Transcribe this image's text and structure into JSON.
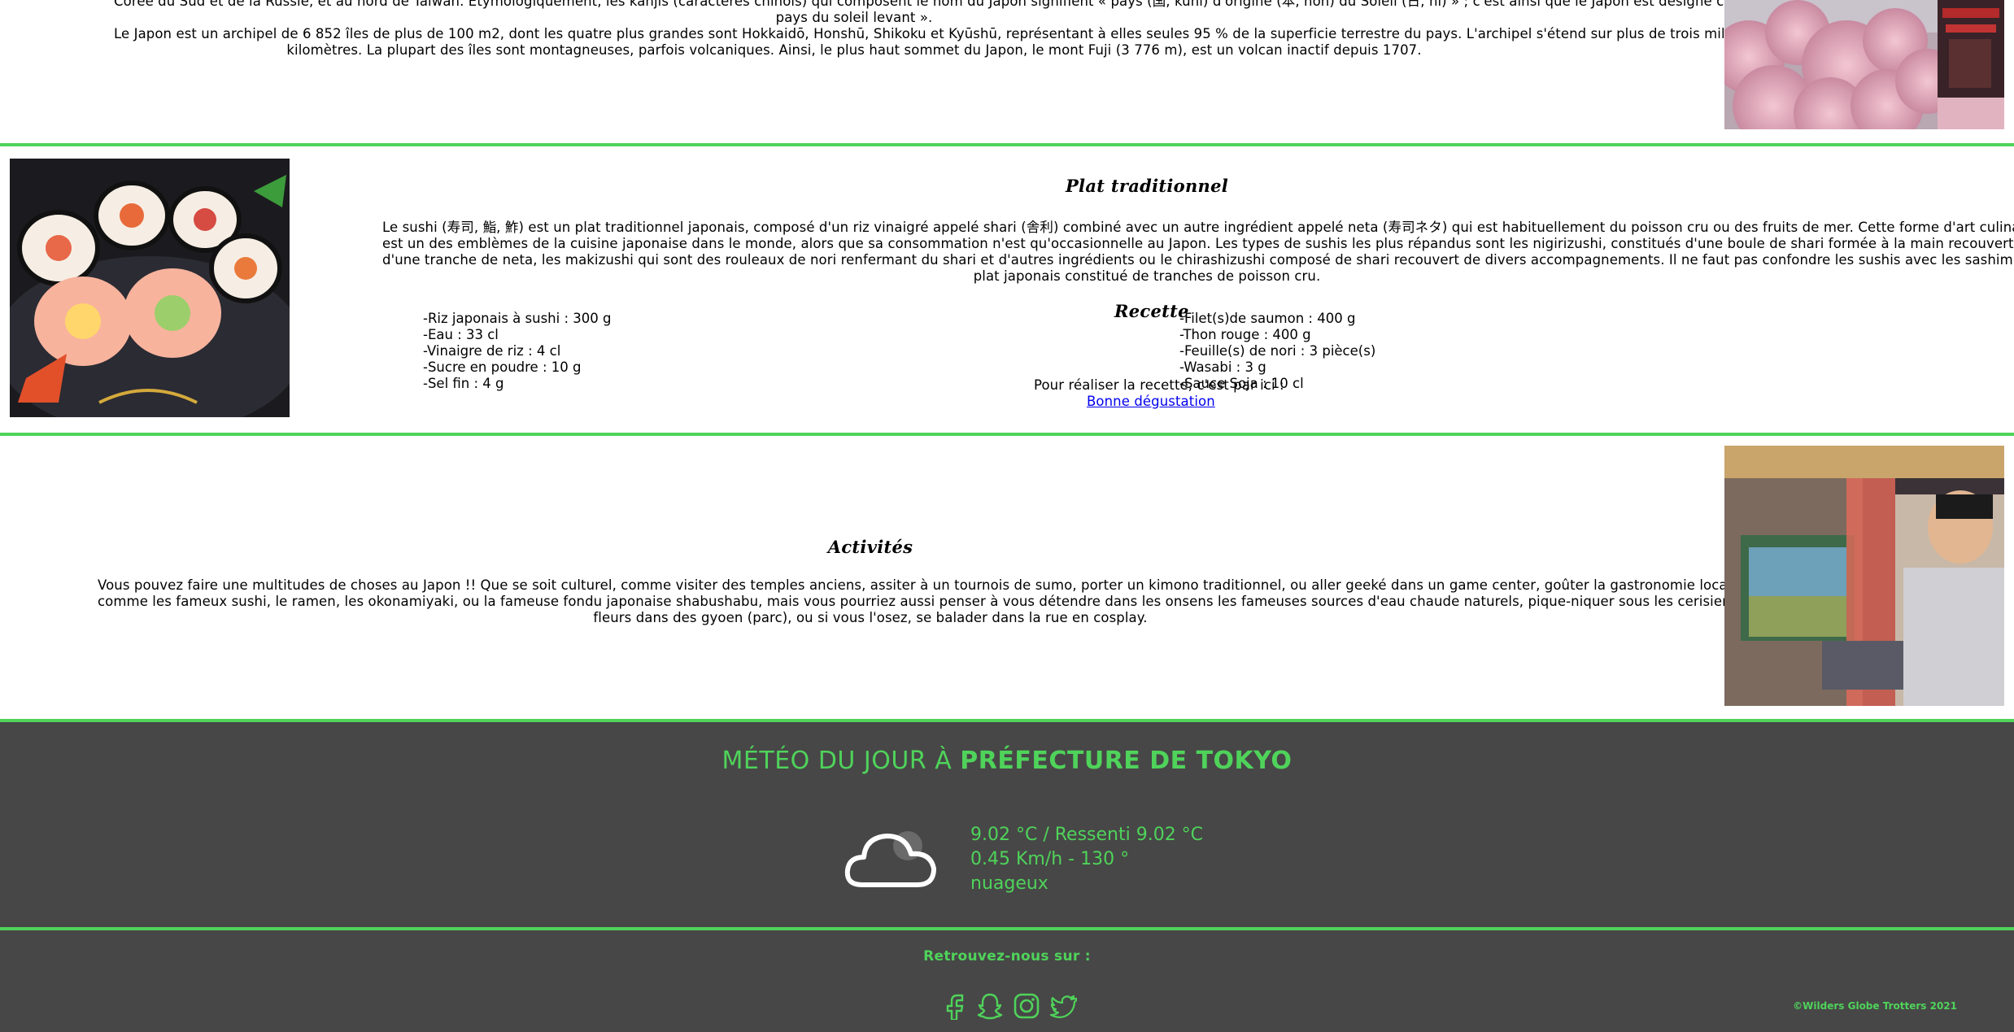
{
  "intro": {
    "line1": "Corée du Sud et de la Russie, et au nord de Taïwan. Étymologiquement, les kanjis (caractères chinois) qui composent le nom du Japon signifient « pays (国, kuni) d'origine (本, hon) du Soleil (日, hi) » ; c'est ainsi que le Japon est désigné comme le «",
    "line2": "pays du soleil levant ».",
    "line3": "Le Japon est un archipel de 6 852 îles de plus de 100 m2, dont les quatre plus grandes sont Hokkaidō, Honshū, Shikoku et Kyūshū, représentant à elles seules 95 % de la superficie terrestre du pays. L'archipel s'étend sur plus de trois mille",
    "line4": "kilomètres. La plupart des îles sont montagneuses, parfois volcaniques. Ainsi, le plus haut sommet du Japon, le mont Fuji (3 776 m), est un volcan inactif depuis 1707."
  },
  "plat": {
    "title": "Plat traditionnel",
    "text1": "Le sushi (寿司, 鮨, 鮓) est un plat traditionnel japonais, composé d'un riz vinaigré appelé shari (舎利) combiné avec un autre ingrédient appelé neta (寿司ネタ) qui est habituellement du poisson cru ou des fruits de mer. Cette forme d'art culinaire",
    "text2": "est un des emblèmes de la cuisine japonaise dans le monde, alors que sa consommation n'est qu'occasionnelle au Japon. Les types de sushis les plus répandus sont les nigirizushi, constitués d'une boule de shari formée à la main recouverte",
    "text3": "d'une tranche de neta, les makizushi qui sont des rouleaux de nori renfermant du shari et d'autres ingrédients ou le chirashizushi composé de shari recouvert de divers accompagnements. Il ne faut pas confondre les sushis avec les sashimis, un",
    "text4": "plat japonais constitué de tranches de poisson cru.",
    "recette_title": "Recette",
    "ingredients_left": [
      "-Riz japonais à sushi : 300 g",
      "-Eau : 33 cl",
      "-Vinaigre de riz : 4 cl",
      "-Sucre en poudre : 10 g",
      "-Sel fin : 4 g"
    ],
    "ingredients_right": [
      "-Filet(s)de saumon : 400 g",
      "-Thon rouge : 400 g",
      "-Feuille(s) de nori : 3 pièce(s)",
      "-Wasabi : 3 g",
      "-Sauce Soja : 10 cl"
    ],
    "recette_text": "Pour réaliser la recette, c'est par ici :",
    "link_text": "Bonne dégustation"
  },
  "activites": {
    "title": "Activités",
    "text1": "Vous pouvez faire une multitudes de choses au Japon !! Que se soit culturel, comme visiter des temples anciens, assiter à un tournois de sumo, porter un kimono traditionnel, ou aller geeké dans un game center, goûter la gastronomie local,",
    "text2": "comme les fameux sushi, le ramen, les okonamiyaki, ou la fameuse fondu japonaise shabushabu, mais vous pourriez aussi penser à vous détendre dans les onsens les fameuses sources d'eau chaude naturels, pique-niquer sous les cerisiers en",
    "text3": "fleurs dans des gyoen (parc), ou si vous l'osez, se balader dans la rue en cosplay."
  },
  "meteo": {
    "title_prefix": "MÉTÉO DU JOUR À",
    "city": "PRÉFECTURE DE TOKYO",
    "temperature": "9.02 °C / Ressenti 9.02 °C",
    "wind": "0.45 Km/h - 130 °",
    "description": "nuageux",
    "icon": "cloud-icon"
  },
  "footer": {
    "follow": "Retrouvez-nous sur :",
    "copyright": "©Wilders Globe Trotters 2021",
    "socials": [
      "facebook-icon",
      "snapchat-icon",
      "instagram-icon",
      "twitter-icon"
    ]
  },
  "colors": {
    "accent": "#4fd35a",
    "footer_bg": "#474747"
  }
}
